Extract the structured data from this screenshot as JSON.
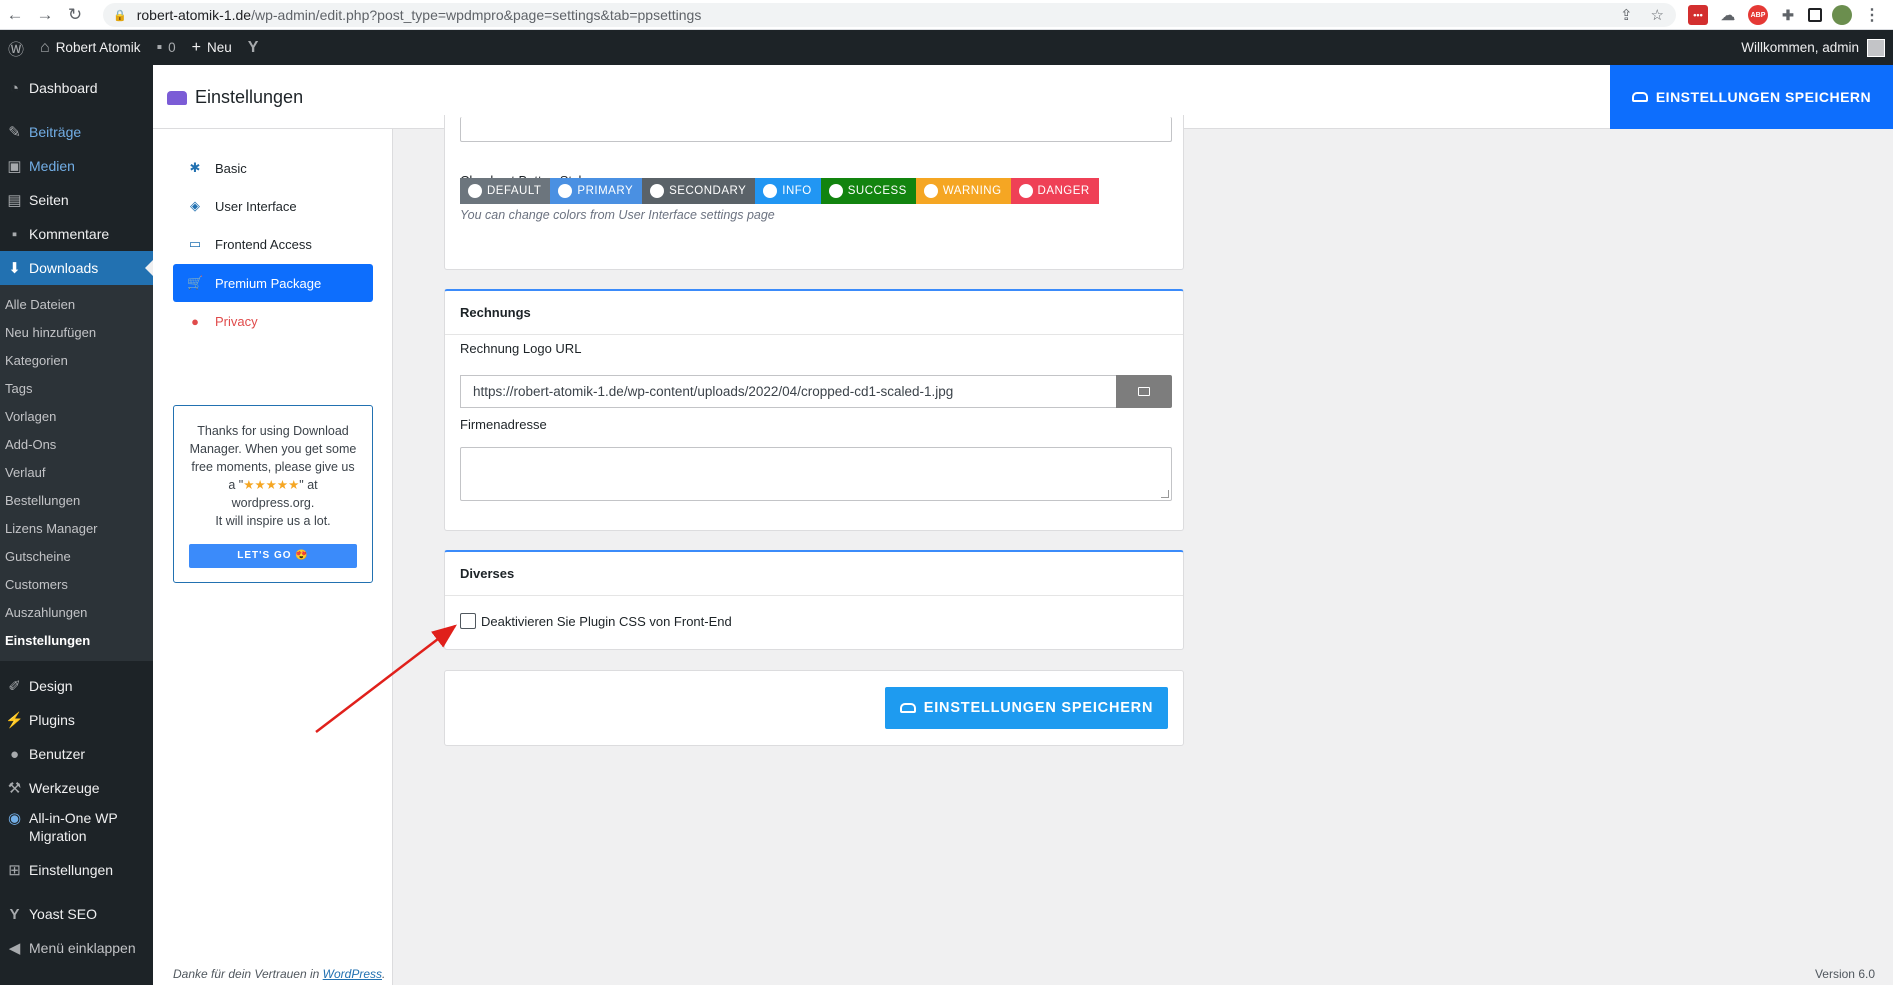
{
  "browser": {
    "url_domain": "robert-atomik-1.de",
    "url_path": "/wp-admin/edit.php?post_type=wpdmpro&page=settings&tab=ppsettings",
    "ext_labels": [
      "ABP"
    ]
  },
  "adminbar": {
    "site_name": "Robert Atomik",
    "comments_count": "0",
    "new_label": "Neu",
    "welcome": "Willkommen, admin"
  },
  "sidebar": {
    "items_top": [
      {
        "label": "Dashboard",
        "icon": "dashboard-icon"
      },
      {
        "label": "Beiträge",
        "icon": "pin-icon"
      },
      {
        "label": "Medien",
        "icon": "media-icon"
      },
      {
        "label": "Seiten",
        "icon": "page-icon"
      },
      {
        "label": "Kommentare",
        "icon": "comment-icon"
      },
      {
        "label": "Downloads",
        "icon": "download-icon"
      }
    ],
    "submenu": [
      "Alle Dateien",
      "Neu hinzufügen",
      "Kategorien",
      "Tags",
      "Vorlagen",
      "Add-Ons",
      "Verlauf",
      "Bestellungen",
      "Lizens Manager",
      "Gutscheine",
      "Customers",
      "Auszahlungen",
      "Einstellungen"
    ],
    "items_bottom": [
      {
        "label": "Design",
        "icon": "brush-icon"
      },
      {
        "label": "Plugins",
        "icon": "plugin-icon"
      },
      {
        "label": "Benutzer",
        "icon": "user-icon"
      },
      {
        "label": "Werkzeuge",
        "icon": "wrench-icon"
      },
      {
        "label": "All-in-One WP Migration",
        "icon": "migration-icon"
      },
      {
        "label": "Einstellungen",
        "icon": "settings-icon"
      },
      {
        "label": "Yoast SEO",
        "icon": "yoast-icon"
      },
      {
        "label": "Menü einklappen",
        "icon": "collapse-icon"
      }
    ]
  },
  "header": {
    "title": "Einstellungen",
    "save_label": "EINSTELLUNGEN SPEICHERN"
  },
  "settings_nav": {
    "items": [
      "Basic",
      "User Interface",
      "Frontend Access",
      "Premium Package",
      "Privacy"
    ],
    "rate_text_1": "Thanks for using Download Manager. When you get some free moments, please give us a \"",
    "rate_stars": "★★★★★",
    "rate_text_2": "\" at wordpress.org.",
    "rate_text_3": "It will inspire us a lot.",
    "rate_button": "LET'S GO 😍"
  },
  "checkout": {
    "label": "Checkout Button Style:",
    "styles": [
      {
        "label": "DEFAULT",
        "color": "#6c757d"
      },
      {
        "label": "PRIMARY",
        "color": "#4a90e2"
      },
      {
        "label": "SECONDARY",
        "color": "#5a6268"
      },
      {
        "label": "INFO",
        "color": "#2196f3"
      },
      {
        "label": "SUCCESS",
        "color": "#12840f"
      },
      {
        "label": "WARNING",
        "color": "#f5a623"
      },
      {
        "label": "DANGER",
        "color": "#ef4056"
      }
    ],
    "hint": "You can change colors from User Interface settings page"
  },
  "invoice": {
    "heading": "Rechnungs",
    "logo_label": "Rechnung Logo URL",
    "logo_value": "https://robert-atomik-1.de/wp-content/uploads/2022/04/cropped-cd1-scaled-1.jpg",
    "address_label": "Firmenadresse"
  },
  "misc": {
    "heading": "Diverses",
    "checkbox_label": "Deaktivieren Sie Plugin CSS von Front-End"
  },
  "footer": {
    "save_label": "EINSTELLUNGEN SPEICHERN",
    "thanks_prefix": "Danke für dein Vertrauen in ",
    "thanks_link": "WordPress",
    "thanks_suffix": ".",
    "version": "Version 6.0"
  },
  "colors": {
    "accent": "#0d6efd",
    "wp_dark": "#1d2327",
    "arrow": "#e0201b"
  }
}
